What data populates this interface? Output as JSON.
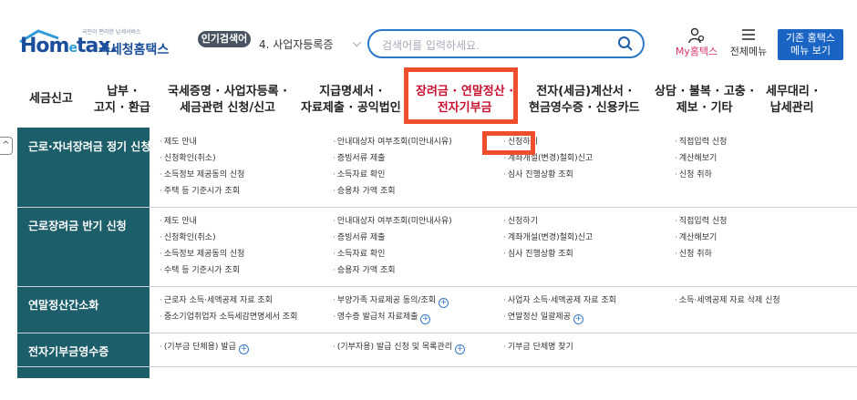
{
  "header": {
    "logo_slogan": "국민이 편리한 납세서비스",
    "logo_brand_a": "Hom",
    "logo_brand_e": "e",
    "logo_brand_b": "tax.",
    "logo_kname": "국세청홈택스",
    "popular_label": "인기검색어",
    "popular_value": "4.  사업자등록증",
    "search_placeholder": "검색어를 입력하세요.",
    "my_home": "My홈택스",
    "all_menu": "전체메뉴",
    "old_home_line1": "기존 홈택스",
    "old_home_line2": "메뉴 보기"
  },
  "nav": [
    {
      "l1": "세금신고",
      "l2": ""
    },
    {
      "l1": "납부 ·",
      "l2": "고지 · 환급"
    },
    {
      "l1": "국세증명 · 사업자등록 ·",
      "l2": "세금관련 신청/신고"
    },
    {
      "l1": "지급명세서 ·",
      "l2": "자료제출 · 공익법인"
    },
    {
      "l1": "장려금 · 연말정산 ·",
      "l2": "전자기부금"
    },
    {
      "l1": "전자(세금)계산서 ·",
      "l2": "현금영수증 · 신용카드"
    },
    {
      "l1": "상담 · 불복 · 고충 ·",
      "l2": "제보 · 기타"
    },
    {
      "l1": "세무대리 ·",
      "l2": "납세관리"
    }
  ],
  "sections": [
    {
      "title": "근로·자녀장려금 정기 신청",
      "links": [
        [
          "제도 안내",
          "안내대상자 여부조회(미안내시유)",
          "신청하기",
          "직접입력 신청"
        ],
        [
          "신청확인(취소)",
          "증빙서류 제출",
          "계좌개설(변경)철회)신고",
          "계산해보기"
        ],
        [
          "소득정보 제공동의 신청",
          "소득자료 확인",
          "심사 진행상황 조회",
          "신청 취하"
        ],
        [
          "주택 등 기준시가 조회",
          "승용차 가액 조회",
          "",
          ""
        ]
      ]
    },
    {
      "title": "근로장려금 반기 신청",
      "links": [
        [
          "제도 안내",
          "안내대상자 여부조회(미안내사유)",
          "신청하기",
          "직접입력 신청"
        ],
        [
          "신청확인(취소)",
          "증빙서류 제출",
          "계좌개설(변경)철회)신고",
          "계산해보기"
        ],
        [
          "소득정보 제공동의 신청",
          "소득자료 확인",
          "심사 진행상황 조회",
          "신청 취하"
        ],
        [
          "수택 등 기준시가 조회",
          "승용자 가액 조회",
          "",
          ""
        ]
      ]
    },
    {
      "title": "연말정산간소화",
      "links": [
        [
          "근로자 소득·세액공제 자료 조회",
          "부양가족 자료제공 동의/조회",
          "사업자 소득·세액공제 자료 조회",
          "소득·세액공제 자료 삭제 신청"
        ],
        [
          "중소기업취업자 소득세감면명세서 조회",
          "영수증 발급처 자료제출",
          "연말정산 일괄제공",
          ""
        ]
      ]
    },
    {
      "title": "전자기부금영수증",
      "links": [
        [
          "(기부금 단체용) 발급",
          "(기부자용) 발급 신청 및 목록관리",
          "기부금 단체명 찾기",
          ""
        ]
      ]
    }
  ]
}
